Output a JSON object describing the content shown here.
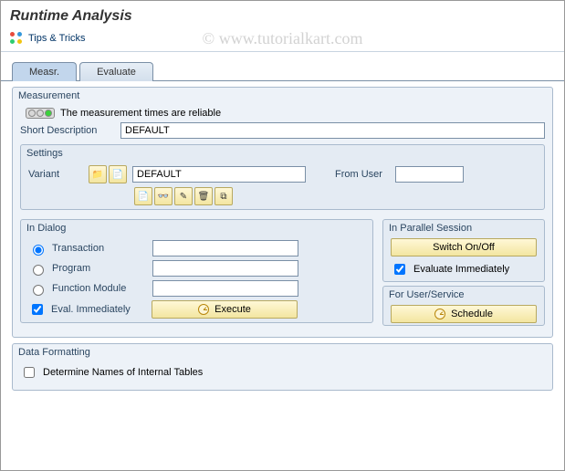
{
  "title": "Runtime Analysis",
  "toolbar": {
    "tips": "Tips & Tricks"
  },
  "tabs": {
    "measure": "Measr.",
    "evaluate": "Evaluate"
  },
  "measurement": {
    "group": "Measurement",
    "status": "The measurement times are reliable",
    "short_desc_label": "Short Description",
    "short_desc_value": "DEFAULT",
    "settings": {
      "group": "Settings",
      "variant_label": "Variant",
      "variant_value": "DEFAULT",
      "from_user_label": "From User",
      "from_user_value": ""
    }
  },
  "in_dialog": {
    "group": "In Dialog",
    "transaction": "Transaction",
    "program": "Program",
    "function_module": "Function Module",
    "eval_immediately": "Eval. Immediately",
    "execute": "Execute"
  },
  "parallel": {
    "group": "In Parallel Session",
    "switch": "Switch On/Off",
    "evaluate": "Evaluate Immediately"
  },
  "for_user": {
    "group": "For User/Service",
    "schedule": "Schedule"
  },
  "data_formatting": {
    "group": "Data Formatting",
    "determine": "Determine Names of Internal Tables"
  },
  "watermark": "© www.tutorialkart.com"
}
